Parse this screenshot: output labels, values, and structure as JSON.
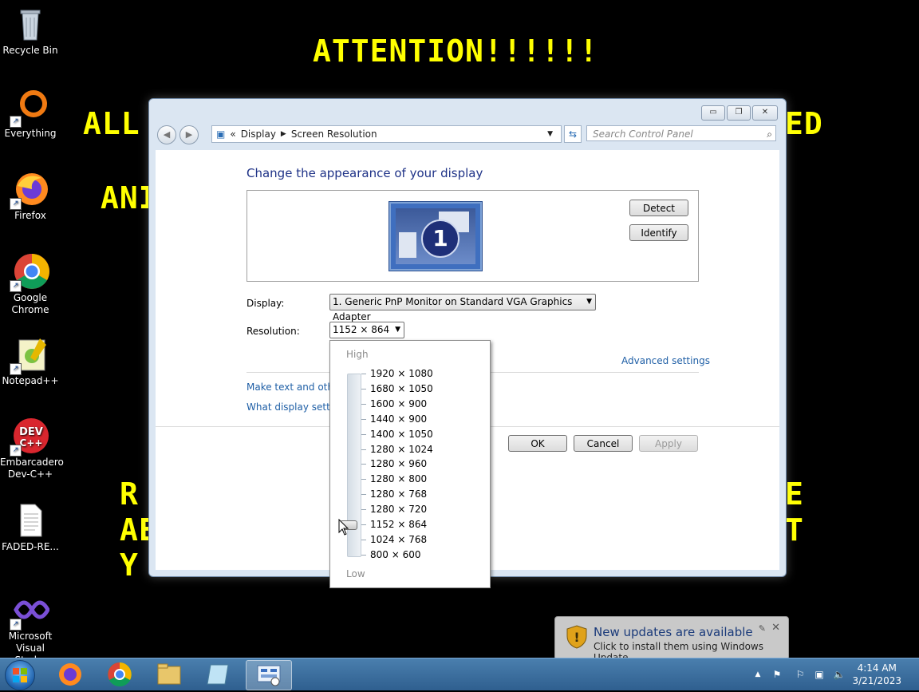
{
  "wallpaper": {
    "line1": "ATTENTION!!!!!!",
    "line2a": "ALL T",
    "line2b": "ED",
    "line3": "ANI",
    "line4a": "R",
    "line4b": "E",
    "line5a": "AE",
    "line5b": "T",
    "line6": "Y"
  },
  "desktop_icons": [
    {
      "label": "Recycle Bin",
      "icon": "recycle-bin-icon"
    },
    {
      "label": "Everything",
      "icon": "everything-icon"
    },
    {
      "label": "Firefox",
      "icon": "firefox-icon"
    },
    {
      "label": "Google Chrome",
      "icon": "chrome-icon"
    },
    {
      "label": "Notepad++",
      "icon": "notepadpp-icon"
    },
    {
      "label": "Embarcadero Dev-C++",
      "icon": "devcpp-icon"
    },
    {
      "label": "FADED-RE...",
      "icon": "document-icon"
    },
    {
      "label": "Microsoft Visual Stud...",
      "icon": "visual-studio-icon"
    }
  ],
  "window": {
    "breadcrumb_sep": "«",
    "breadcrumb": [
      "Display",
      "Screen Resolution"
    ],
    "search_placeholder": "Search Control Panel",
    "heading": "Change the appearance of your display",
    "monitor_number": "1",
    "detect_label": "Detect",
    "identify_label": "Identify",
    "display_label": "Display:",
    "display_value": "1. Generic PnP Monitor on Standard VGA Graphics Adapter",
    "resolution_label": "Resolution:",
    "resolution_value": "1152 × 864",
    "advanced_link": "Advanced settings",
    "link1": "Make text and other",
    "link2": "What display setting",
    "ok_label": "OK",
    "cancel_label": "Cancel",
    "apply_label": "Apply"
  },
  "resolution_dropdown": {
    "high_label": "High",
    "low_label": "Low",
    "options": [
      "1920 × 1080",
      "1680 × 1050",
      "1600 × 900",
      "1440 × 900",
      "1400 × 1050",
      "1280 × 1024",
      "1280 × 960",
      "1280 × 800",
      "1280 × 768",
      "1280 × 720",
      "1152 × 864",
      "1024 × 768",
      "800 × 600"
    ],
    "selected": "1152 × 864"
  },
  "notification": {
    "title": "New updates are available",
    "message": "Click to install them using Windows Update."
  },
  "taskbar": {
    "time": "4:14 AM",
    "date": "3/21/2023"
  },
  "colors": {
    "wallpaper_text": "#ffff00",
    "link": "#1f5fa6",
    "heading": "#1e3287",
    "taskbar": "#2f5f8f"
  }
}
